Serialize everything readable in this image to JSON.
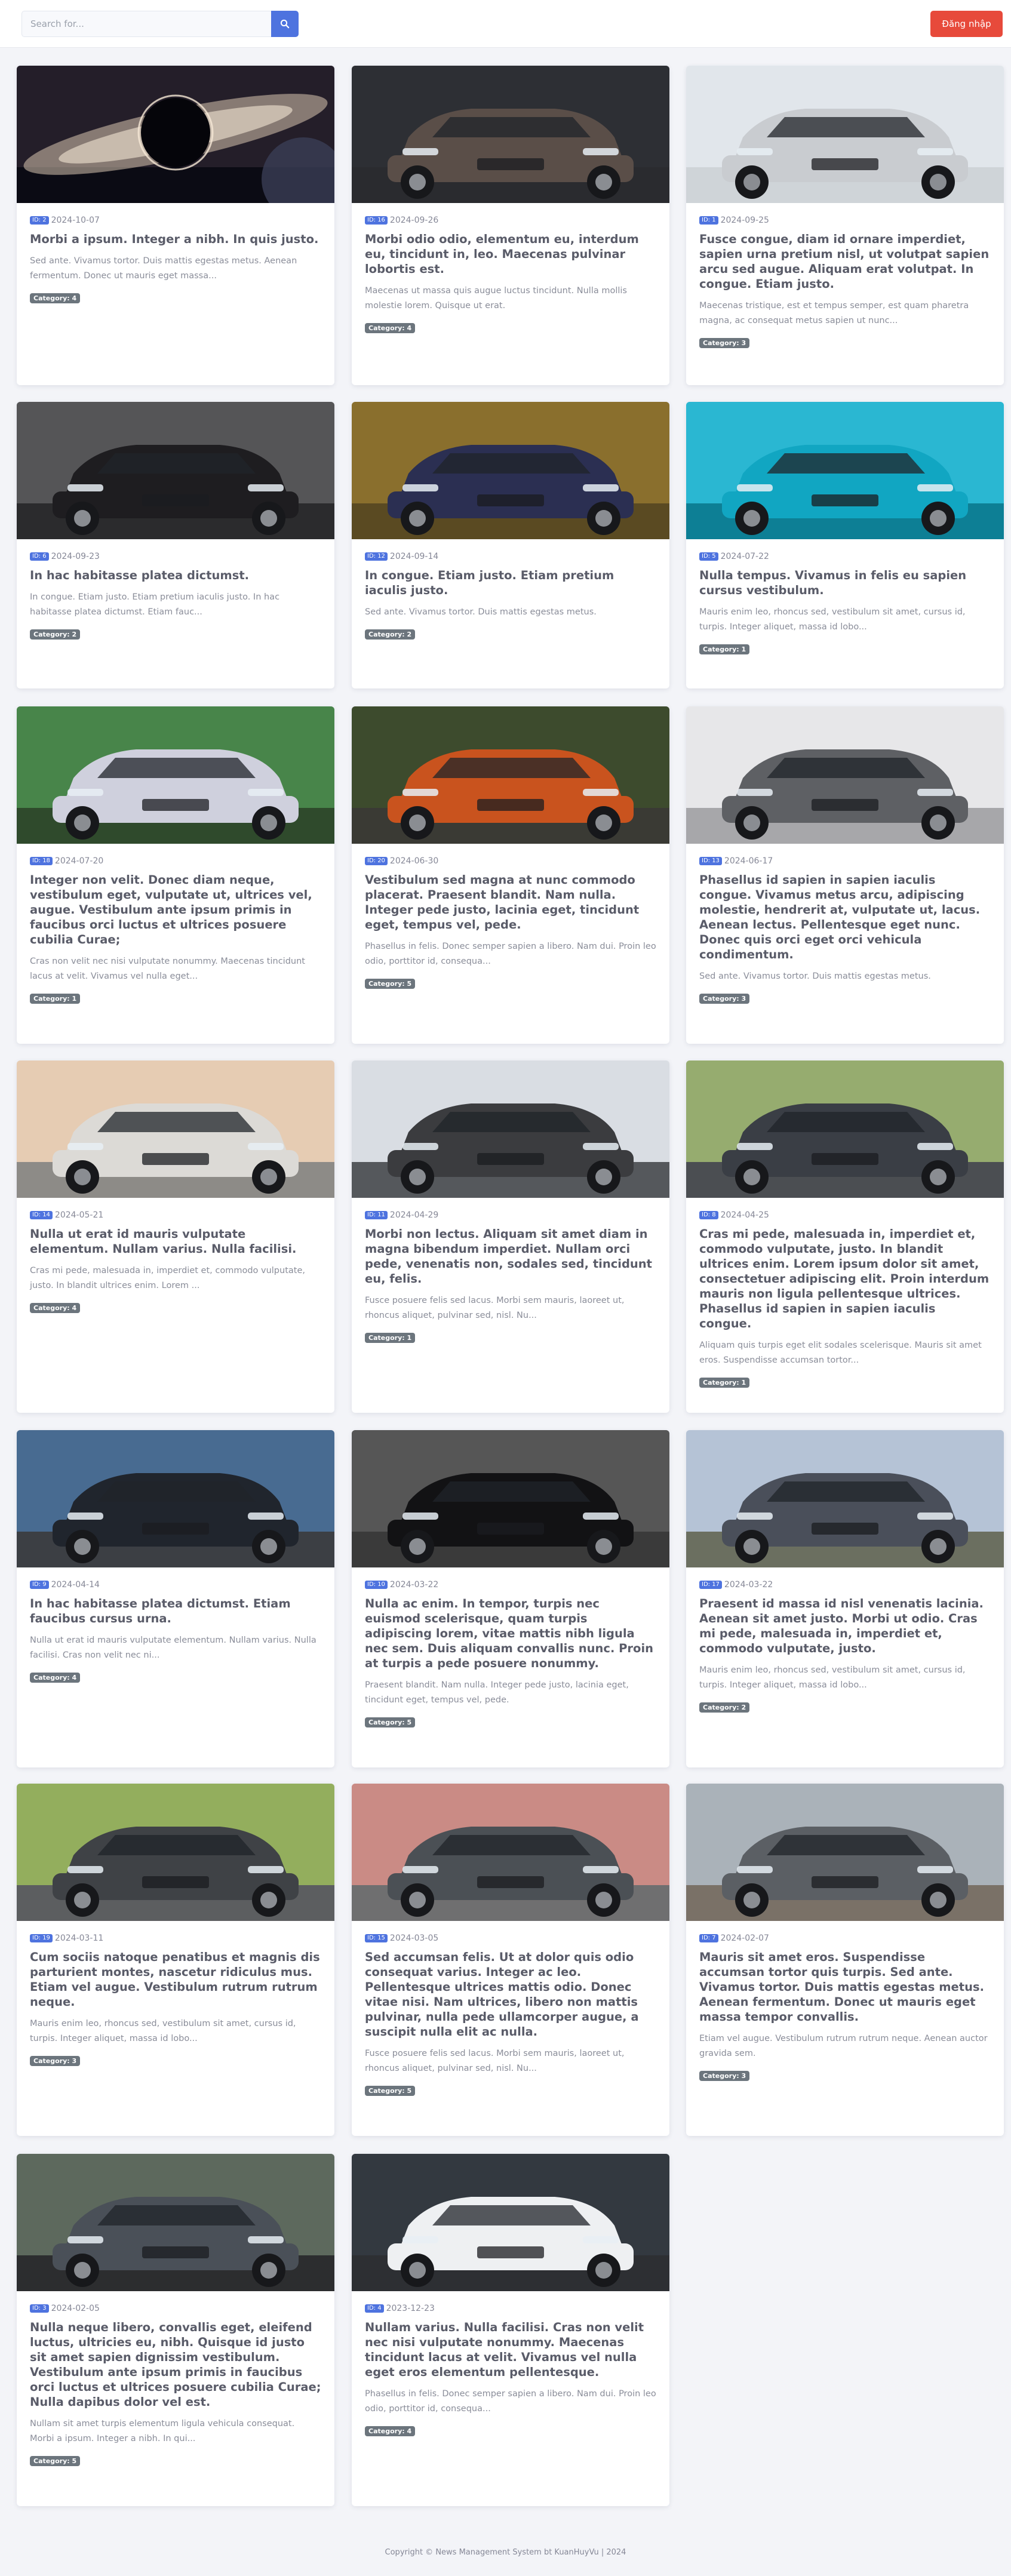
{
  "header": {
    "search_placeholder": "Search for...",
    "search_icon": "search-icon",
    "login_label": "Đăng nhập"
  },
  "colors": {
    "primary": "#4e73df",
    "danger": "#e74a3b",
    "badge": "#6c757d"
  },
  "articles": [
    {
      "id": "ID: 2",
      "date": "2024-10-07",
      "title": "Morbi a ipsum. Integer a nibh. In quis justo.",
      "summary": "Sed ante. Vivamus tortor. Duis mattis egestas metus. Aenean fermentum. Donec ut mauris eget massa...",
      "category": "Category: 4",
      "image": "black hole in space"
    },
    {
      "id": "ID: 16",
      "date": "2024-09-26",
      "title": "Morbi odio odio, elementum eu, interdum eu, tincidunt in, leo. Maecenas pulvinar lobortis est.",
      "summary": "Maecenas ut massa quis augue luctus tincidunt. Nulla mollis molestie lorem. Quisque ut erat.",
      "category": "Category: 4",
      "image": "dark SUV, Xforce"
    },
    {
      "id": "ID: 1",
      "date": "2024-09-25",
      "title": "Fusce congue, diam id ornare imperdiet, sapien urna pretium nisl, ut volutpat sapien arcu sed augue. Aliquam erat volutpat. In congue. Etiam justo.",
      "summary": "Maecenas tristique, est et tempus semper, est quam pharetra magna, ac consequat metus sapien ut nunc...",
      "category": "Category: 3",
      "image": "silver HR-V SUV"
    },
    {
      "id": "ID: 6",
      "date": "2024-09-23",
      "title": "In hac habitasse platea dictumst.",
      "summary": "In congue. Etiam justo. Etiam pretium iaculis justo. In hac habitasse platea dictumst. Etiam fauc...",
      "category": "Category: 2",
      "image": "black luxury sedan"
    },
    {
      "id": "ID: 12",
      "date": "2024-09-14",
      "title": "In congue. Etiam justo. Etiam pretium iaculis justo.",
      "summary": "Sed ante. Vivamus tortor. Duis mattis egestas metus.",
      "category": "Category: 2",
      "image": "Rolls-Royce in autumn"
    },
    {
      "id": "ID: 5",
      "date": "2024-07-22",
      "title": "Nulla tempus. Vivamus in felis eu sapien cursus vestibulum.",
      "summary": "Mauris enim leo, rhoncus sed, vestibulum sit amet, cursus id, turpis. Integer aliquet, massa id lobo...",
      "category": "Category: 1",
      "image": "blue 408 hatchback"
    },
    {
      "id": "ID: 18",
      "date": "2024-07-20",
      "title": "Integer non velit. Donec diam neque, vestibulum eget, vulputate ut, ultrices vel, augue. Vestibulum ante ipsum primis in faucibus orci luctus et ultrices posuere cubilia Curae;",
      "summary": "Cras non velit nec nisi vulputate nonummy. Maecenas tincidunt lacus at velit. Vivamus vel nulla eget...",
      "category": "Category: 1",
      "image": "white VF7 crossover"
    },
    {
      "id": "ID: 20",
      "date": "2024-06-30",
      "title": "Vestibulum sed magna at nunc commodo placerat. Praesent blandit. Nam nulla. Integer pede justo, lacinia eget, tincidunt eget, tempus vel, pede.",
      "summary": "Phasellus in felis. Donec semper sapien a libero. Nam dui. Proin leo odio, porttitor id, consequa...",
      "category": "Category: 5",
      "image": "orange XL7 SUV"
    },
    {
      "id": "ID: 13",
      "date": "2024-06-17",
      "title": "Phasellus id sapien in sapien iaculis congue. Vivamus metus arcu, adipiscing molestie, hendrerit at, vulputate ut, lacus. Aenean lectus. Pellentesque eget nunc. Donec quis orci eget orci vehicula condimentum.",
      "summary": "Sed ante. Vivamus tortor. Duis mattis egestas metus.",
      "category": "Category: 3",
      "image": "grey crossover"
    },
    {
      "id": "ID: 14",
      "date": "2024-05-21",
      "title": "Nulla ut erat id mauris vulputate elementum. Nullam varius. Nulla facilisi.",
      "summary": "Cras mi pede, malesuada in, imperdiet et, commodo vulputate, justo. In blandit ultrices enim. Lorem ...",
      "category": "Category: 4",
      "image": "white SUV at beach"
    },
    {
      "id": "ID: 11",
      "date": "2024-04-29",
      "title": "Morbi non lectus. Aliquam sit amet diam in magna bibendum imperdiet. Nullam orci pede, venenatis non, sodales sed, tincidunt eu, felis.",
      "summary": "Fusce posuere felis sed lacus. Morbi sem mauris, laoreet ut, rhoncus aliquet, pulvinar sed, nisl. Nu...",
      "category": "Category: 1",
      "image": "grey Mini Countryman"
    },
    {
      "id": "ID: 8",
      "date": "2024-04-25",
      "title": "Cras mi pede, malesuada in, imperdiet et, commodo vulputate, justo. In blandit ultrices enim. Lorem ipsum dolor sit amet, consectetuer adipiscing elit. Proin interdum mauris non ligula pellentesque ultrices. Phasellus id sapien in sapien iaculis congue.",
      "summary": "Aliquam quis turpis eget elit sodales scelerisque. Mauris sit amet eros. Suspendisse accumsan tortor...",
      "category": "Category: 1",
      "image": "dark Mercedes SUV"
    },
    {
      "id": "ID: 9",
      "date": "2024-04-14",
      "title": "In hac habitasse platea dictumst. Etiam faucibus cursus urna.",
      "summary": "Nulla ut erat id mauris vulputate elementum. Nullam varius. Nulla facilisi. Cras non velit nec ni...",
      "category": "Category: 4",
      "image": "dark sedan, Lux A"
    },
    {
      "id": "ID: 10",
      "date": "2024-03-22",
      "title": "Nulla ac enim. In tempor, turpis nec euismod scelerisque, quam turpis adipiscing lorem, vitae mattis nibh ligula nec sem. Duis aliquam convallis nunc. Proin at turpis a pede posuere nonummy.",
      "summary": "Praesent blandit. Nam nulla. Integer pede justo, lacinia eget, tincidunt eget, tempus vel, pede.",
      "category": "Category: 5",
      "image": "black Porsche Cayenne"
    },
    {
      "id": "ID: 17",
      "date": "2024-03-22",
      "title": "Praesent id massa id nisl venenatis lacinia. Aenean sit amet justo. Morbi ut odio. Cras mi pede, malesuada in, imperdiet et, commodo vulputate, justo.",
      "summary": "Mauris enim leo, rhoncus sed, vestibulum sit amet, cursus id, turpis. Integer aliquet, massa id lobo...",
      "category": "Category: 2",
      "image": "grey BMW X7"
    },
    {
      "id": "ID: 19",
      "date": "2024-03-11",
      "title": "Cum sociis natoque penatibus et magnis dis parturient montes, nascetur ridiculus mus. Etiam vel augue. Vestibulum rutrum rutrum neque.",
      "summary": "Mauris enim leo, rhoncus sed, vestibulum sit amet, cursus id, turpis. Integer aliquet, massa id lobo...",
      "category": "Category: 3",
      "image": "dark Volvo XC60"
    },
    {
      "id": "ID: 15",
      "date": "2024-03-05",
      "title": "Sed accumsan felis. Ut at dolor quis odio consequat varius. Integer ac leo. Pellentesque ultrices mattis odio. Donec vitae nisi. Nam ultrices, libero non mattis pulvinar, nulla pede ullamcorper augue, a suscipit nulla elit ac nulla.",
      "summary": "Fusce posuere felis sed lacus. Morbi sem mauris, laoreet ut, rhoncus aliquet, pulvinar sed, nisl. Nu...",
      "category": "Category: 5",
      "image": "grey SUV by red wall"
    },
    {
      "id": "ID: 7",
      "date": "2024-02-07",
      "title": "Mauris sit amet eros. Suspendisse accumsan tortor quis turpis. Sed ante. Vivamus tortor. Duis mattis egestas metus. Aenean fermentum. Donec ut mauris eget massa tempor convallis.",
      "summary": "Etiam vel augue. Vestibulum rutrum rutrum neque. Aenean auctor gravida sem.",
      "category": "Category: 3",
      "image": "grey Hyundai on mountain road"
    },
    {
      "id": "ID: 3",
      "date": "2024-02-05",
      "title": "Nulla neque libero, convallis eget, eleifend luctus, ultricies eu, nibh. Quisque id justo sit amet sapien dignissim vestibulum. Vestibulum ante ipsum primis in faucibus orci luctus et ultrices posuere cubilia Curae; Nulla dapibus dolor vel est.",
      "summary": "Nullam sit amet turpis elementum ligula vehicula consequat. Morbi a ipsum. Integer a nibh. In qui...",
      "category": "Category: 5",
      "image": "grey Mazda CX-5"
    },
    {
      "id": "ID: 4",
      "date": "2023-12-23",
      "title": "Nullam varius. Nulla facilisi. Cras non velit nec nisi vulputate nonummy. Maecenas tincidunt lacus at velit. Vivamus vel nulla eget eros elementum pellentesque.",
      "summary": "Phasellus in felis. Donec semper sapien a libero. Nam dui. Proin leo odio, porttitor id, consequa...",
      "category": "Category: 4",
      "image": "white CR-V SUV"
    }
  ],
  "footer": {
    "text": "Copyright © News Management System bt KuanHuyVu | 2024"
  }
}
